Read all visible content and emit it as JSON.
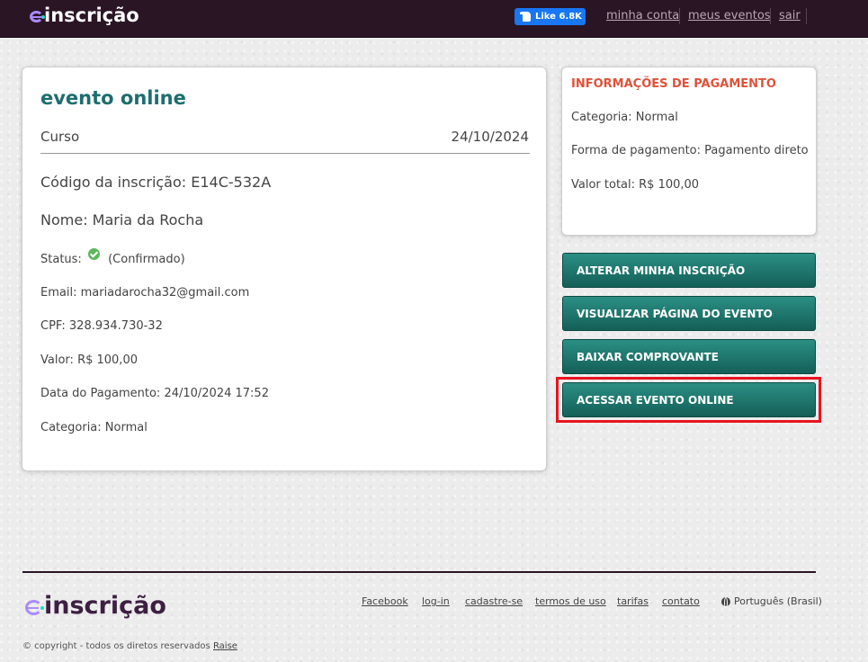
{
  "header": {
    "logo_prefix": "e",
    "logo_text": "inscrição",
    "fb_like_label": "Like 6.8K",
    "nav": {
      "minha_conta": "minha conta",
      "meus_eventos": "meus eventos",
      "sair": "sair"
    }
  },
  "registration": {
    "event_title": "evento online",
    "event_type": "Curso",
    "event_date": "24/10/2024",
    "code_label": "Código da inscrição:",
    "code_value": "E14C-532A",
    "name_label": "Nome:",
    "name_value": "Maria da Rocha",
    "status_label": "Status:",
    "status_value": "(Confirmado)",
    "email_label": "Email:",
    "email_value": "mariadarocha32@gmail.com",
    "cpf_label": "CPF:",
    "cpf_value": "328.934.730-32",
    "valor_label": "Valor:",
    "valor_value": "R$ 100,00",
    "payment_date_label": "Data do Pagamento:",
    "payment_date_value": "24/10/2024 17:52",
    "category_label": "Categoria:",
    "category_value": "Normal"
  },
  "payment_info": {
    "title": "INFORMAÇÕES DE PAGAMENTO",
    "category": "Categoria: Normal",
    "method": "Forma de pagamento: Pagamento direto",
    "total": "Valor total: R$ 100,00"
  },
  "actions": {
    "alter": "ALTERAR MINHA INSCRIÇÃO",
    "view_event": "VISUALIZAR PÁGINA DO EVENTO",
    "download_receipt": "BAIXAR COMPROVANTE",
    "access_online": "ACESSAR EVENTO ONLINE"
  },
  "footer": {
    "logo_text": "inscrição",
    "links": {
      "facebook": "Facebook",
      "login": "log-in",
      "signup": "cadastre-se",
      "terms": "termos de uso",
      "fees": "tarifas",
      "contact": "contato"
    },
    "language": "Português (Brasil)",
    "copyright": "© copyright - todos os diretos reservados",
    "copyright_link": "Raise"
  },
  "colors": {
    "header_bg": "#2a1525",
    "title_teal": "#1e6e6e",
    "button_teal": "#1b746b",
    "payment_title": "#e0523a",
    "highlight_red": "#e8141e"
  }
}
